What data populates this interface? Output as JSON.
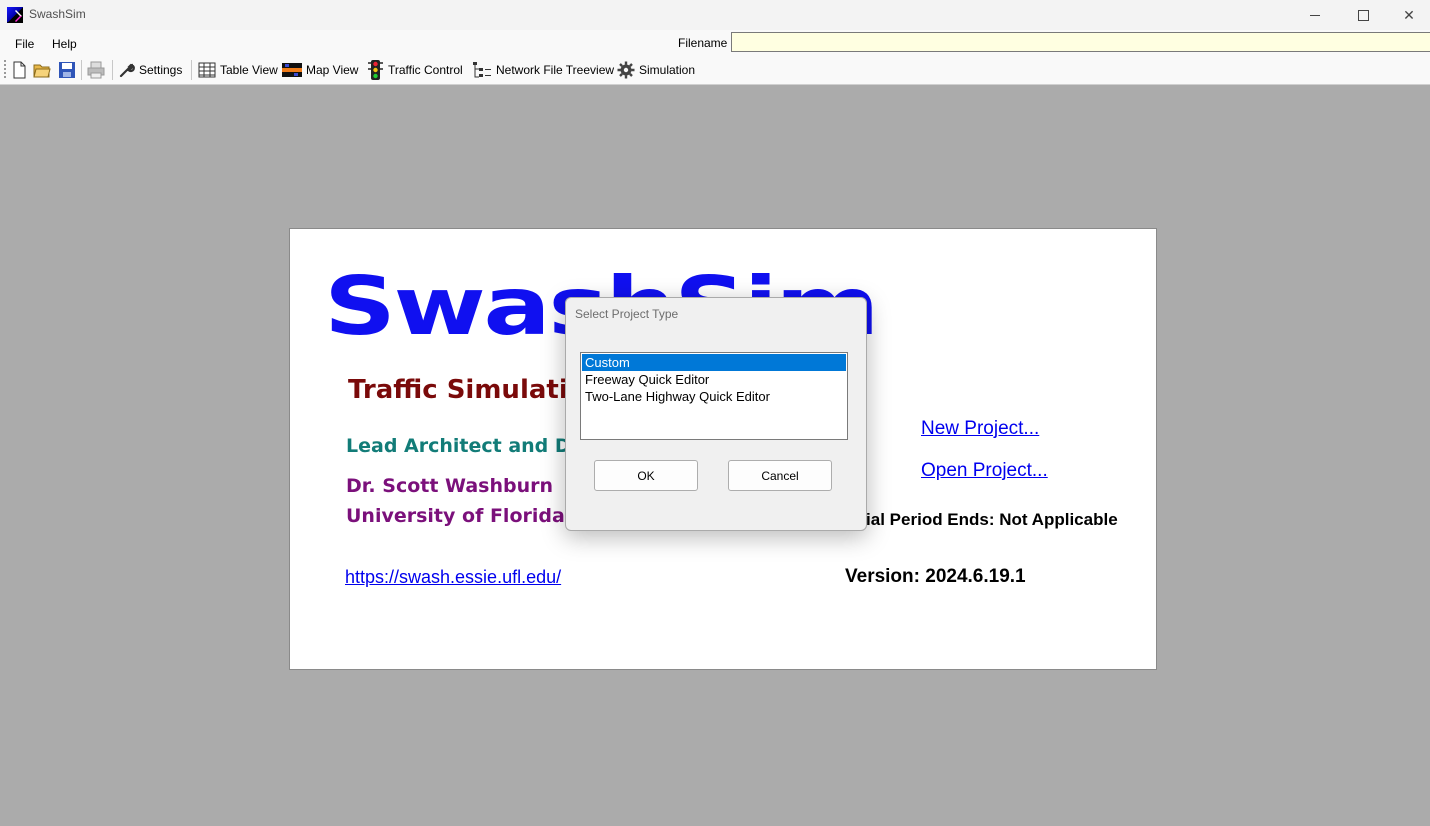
{
  "window": {
    "title": "SwashSim"
  },
  "menu": {
    "file": "File",
    "help": "Help"
  },
  "filename": {
    "label": "Filename",
    "value": ""
  },
  "toolbar": {
    "settings": "Settings",
    "table_view": "Table View",
    "map_view": "Map View",
    "traffic_control": "Traffic Control",
    "network_file_treeview": "Network File Treeview",
    "simulation": "Simulation"
  },
  "splash": {
    "logo": "SwashSim",
    "subtitle": "Traffic Simulation",
    "lead": "Lead Architect and Developer",
    "person": "Dr. Scott Washburn",
    "university": "University of Florida",
    "website": "https://swash.essie.ufl.edu/",
    "new_project": "New Project...",
    "open_project": "Open Project...",
    "period_label": "Trial Period Ends: ",
    "period_value": "Not Applicable",
    "version": "Version: 2024.6.19.1"
  },
  "dialog": {
    "title": "Select Project Type",
    "options": [
      "Custom",
      "Freeway Quick Editor",
      "Two-Lane Highway Quick Editor"
    ],
    "selected": "Custom",
    "ok": "OK",
    "cancel": "Cancel"
  },
  "colors": {
    "selection": "#0078d7",
    "logo": "#1010f0",
    "subtitle": "#7a0a0a",
    "lead": "#127c78",
    "person": "#7b107b",
    "desktop": "#ababab"
  }
}
